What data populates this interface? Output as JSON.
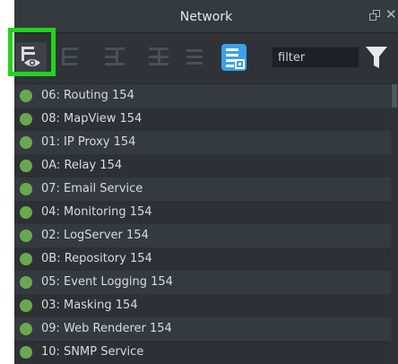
{
  "panel": {
    "title": "Network"
  },
  "toolbar": {
    "filter_placeholder": "filter"
  },
  "nodes": [
    {
      "label": "06: Routing 154",
      "status": "online"
    },
    {
      "label": "08: MapView 154",
      "status": "online"
    },
    {
      "label": "01: IP Proxy 154",
      "status": "online"
    },
    {
      "label": "0A: Relay 154",
      "status": "online"
    },
    {
      "label": "07: Email Service",
      "status": "online"
    },
    {
      "label": "04: Monitoring 154",
      "status": "online"
    },
    {
      "label": "02: LogServer 154",
      "status": "online"
    },
    {
      "label": "0B: Repository 154",
      "status": "online"
    },
    {
      "label": "05: Event Logging 154",
      "status": "online"
    },
    {
      "label": "03: Masking 154",
      "status": "online"
    },
    {
      "label": "09: Web Renderer 154",
      "status": "online"
    },
    {
      "label": "10: SNMP Service",
      "status": "online"
    }
  ],
  "colors": {
    "status_online": "#6aa84f",
    "highlight": "#22d41c",
    "accent": "#3aa1ee"
  }
}
